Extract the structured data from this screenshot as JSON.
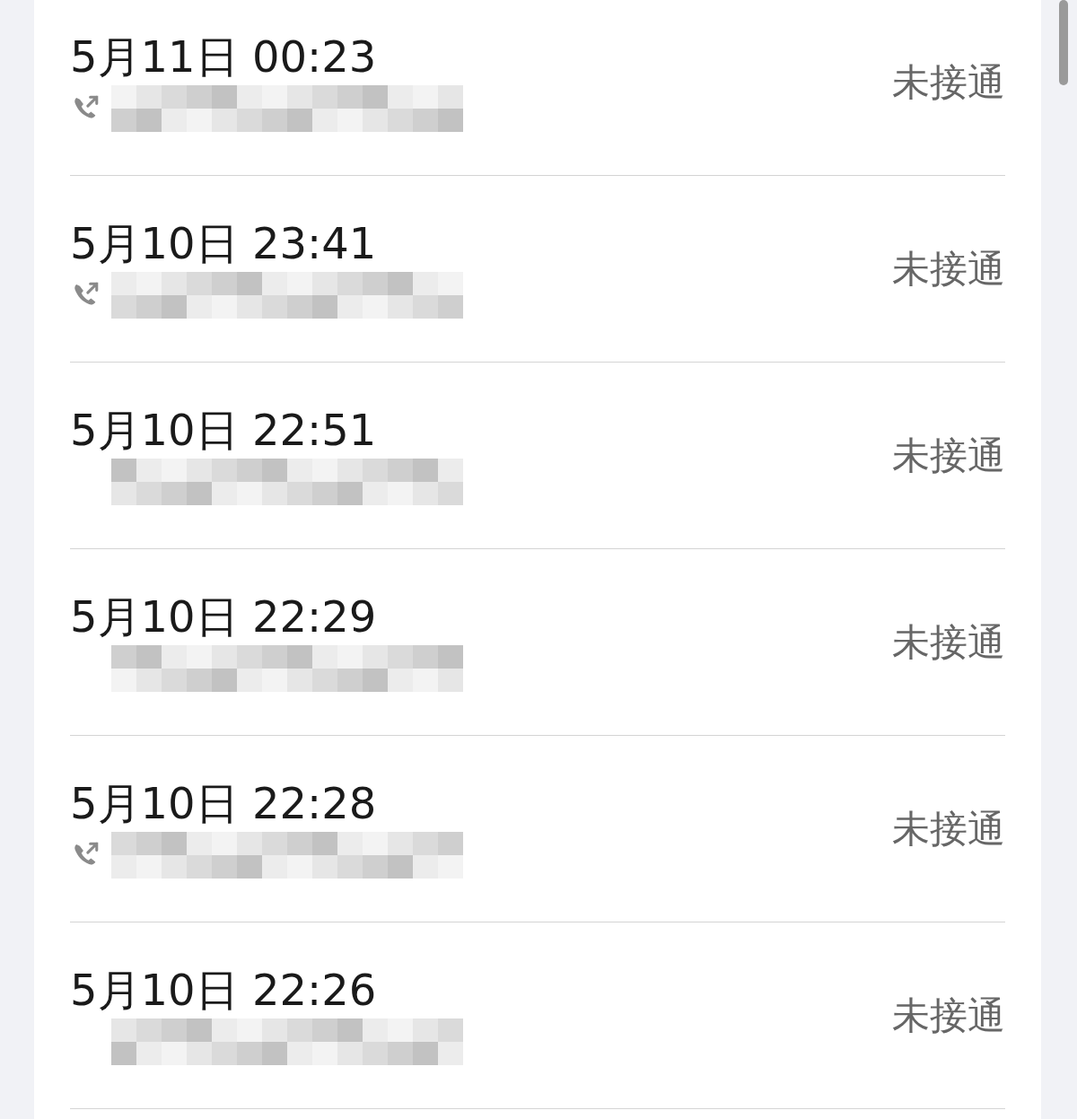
{
  "calls": [
    {
      "time": "5月11日 00:23",
      "status": "未接通",
      "outgoing_icon": true
    },
    {
      "time": "5月10日 23:41",
      "status": "未接通",
      "outgoing_icon": true
    },
    {
      "time": "5月10日 22:51",
      "status": "未接通",
      "outgoing_icon": false
    },
    {
      "time": "5月10日 22:29",
      "status": "未接通",
      "outgoing_icon": false
    },
    {
      "time": "5月10日 22:28",
      "status": "未接通",
      "outgoing_icon": true
    },
    {
      "time": "5月10日 22:26",
      "status": "未接通",
      "outgoing_icon": false
    }
  ]
}
